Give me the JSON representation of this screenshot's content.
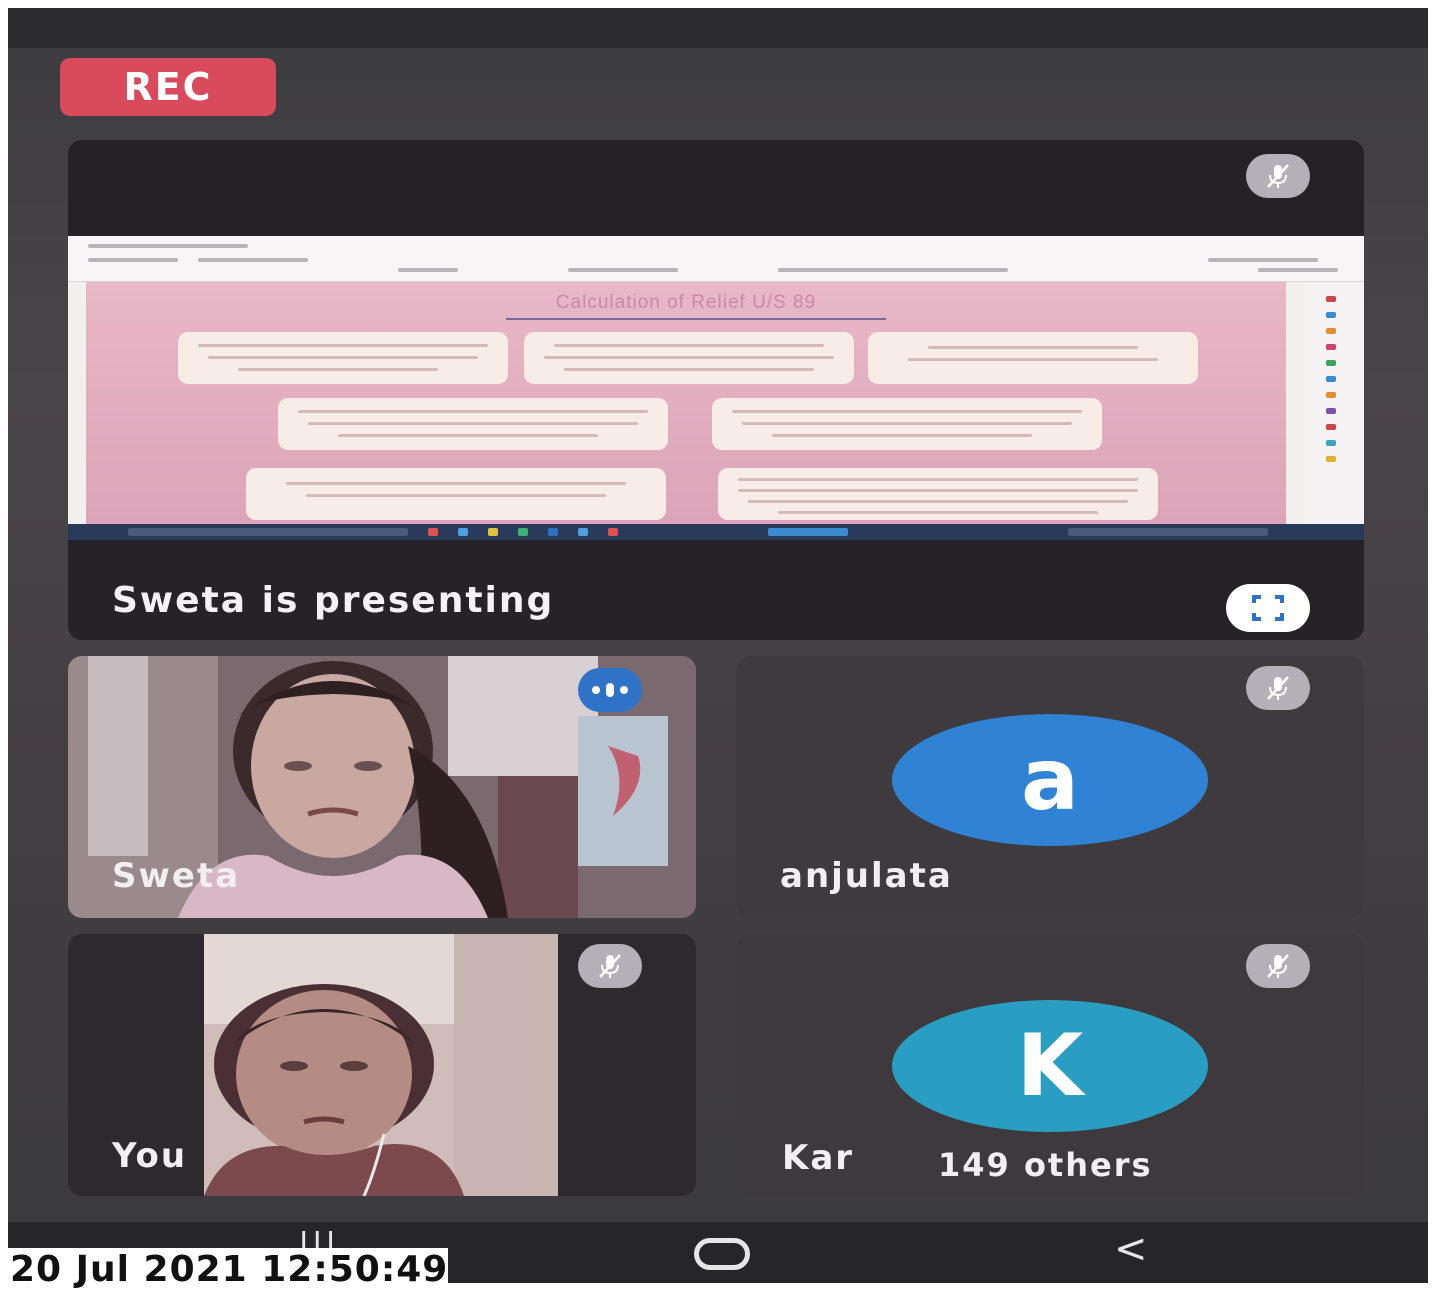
{
  "recording": {
    "label": "REC"
  },
  "presentation": {
    "slide_title": "Calculation of Relief U/S 89",
    "status": "Sweta is presenting",
    "mute_icon": "mic-off-icon",
    "fullscreen_icon": "fullscreen-icon"
  },
  "participants": [
    {
      "name": "Sweta",
      "type": "video",
      "speaking": true
    },
    {
      "name": "anjulata",
      "type": "avatar",
      "initial": "a",
      "avatar_color": "#2f82d4",
      "muted": true
    },
    {
      "name": "You",
      "type": "video",
      "muted": true
    },
    {
      "name": "Kar",
      "type": "avatar",
      "initial": "K",
      "avatar_color": "#2a9ec2",
      "muted": true
    }
  ],
  "others": {
    "label": "149 others"
  },
  "navigation": {
    "recent": "|||",
    "home": "O",
    "back": "<"
  },
  "timestamp": "20 Jul 2021  12:50:49",
  "colors": {
    "rec": "#d94a5c",
    "speaking": "#2f73c9",
    "slide": "#dca4b8"
  }
}
